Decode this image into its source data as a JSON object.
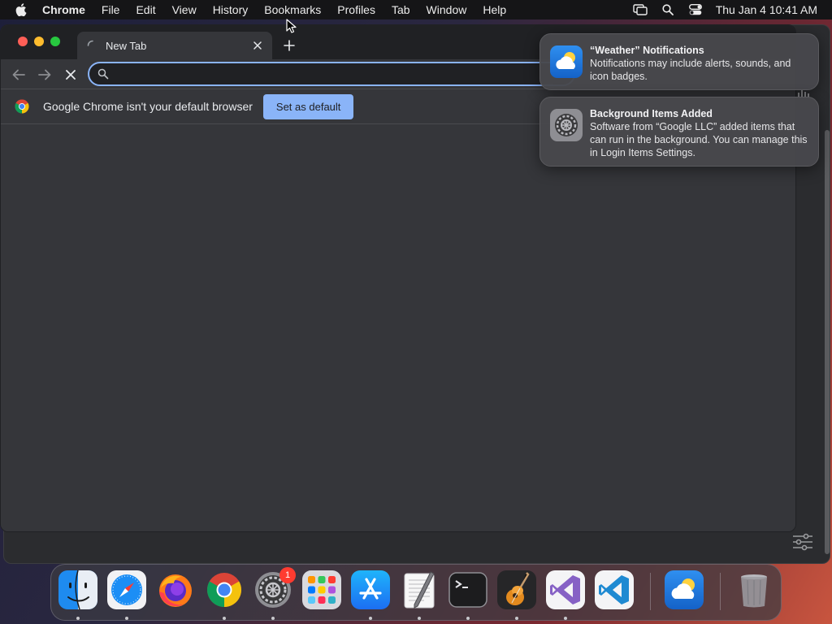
{
  "menubar": {
    "app_name": "Chrome",
    "items": [
      "File",
      "Edit",
      "View",
      "History",
      "Bookmarks",
      "Profiles",
      "Tab",
      "Window",
      "Help"
    ],
    "clock": "Thu Jan 4  10:41 AM",
    "status_icons": [
      "screen-mirroring-icon",
      "spotlight-search-icon",
      "control-center-icon"
    ]
  },
  "browser": {
    "tab": {
      "title": "New Tab"
    },
    "omnibox": {
      "value": "",
      "placeholder": ""
    },
    "infobar": {
      "message": "Google Chrome isn't your default browser",
      "button_label": "Set as default"
    }
  },
  "notifications": [
    {
      "title": "“Weather” Notifications",
      "body": "Notifications may include alerts, sounds, and icon badges.",
      "icon": "weather-app-icon"
    },
    {
      "title": "Background Items Added",
      "body": "Software from “Google LLC” added items that can run in the background. You can manage this in Login Items Settings.",
      "icon": "system-settings-icon"
    }
  ],
  "dock": {
    "apps": [
      {
        "name": "Finder",
        "icon": "finder-icon"
      },
      {
        "name": "Safari",
        "icon": "safari-icon"
      },
      {
        "name": "Firefox",
        "icon": "firefox-icon"
      },
      {
        "name": "Google Chrome",
        "icon": "chrome-icon"
      },
      {
        "name": "System Settings",
        "icon": "system-settings-icon",
        "badge": "1"
      },
      {
        "name": "Launchpad",
        "icon": "launchpad-icon"
      },
      {
        "name": "App Store",
        "icon": "app-store-icon"
      },
      {
        "name": "TextEdit",
        "icon": "textedit-icon"
      },
      {
        "name": "Terminal",
        "icon": "terminal-icon"
      },
      {
        "name": "GarageBand",
        "icon": "garageband-icon"
      },
      {
        "name": "Visual Studio",
        "icon": "visual-studio-icon"
      },
      {
        "name": "Visual Studio Code",
        "icon": "vscode-icon"
      },
      {
        "name": "Weather",
        "icon": "weather-icon"
      },
      {
        "name": "Trash",
        "icon": "trash-icon"
      }
    ]
  },
  "colors": {
    "accent_blue": "#8ab4f8",
    "chrome_dark": "#35363a",
    "tabstrip": "#202124",
    "badge_red": "#ff3b30"
  }
}
